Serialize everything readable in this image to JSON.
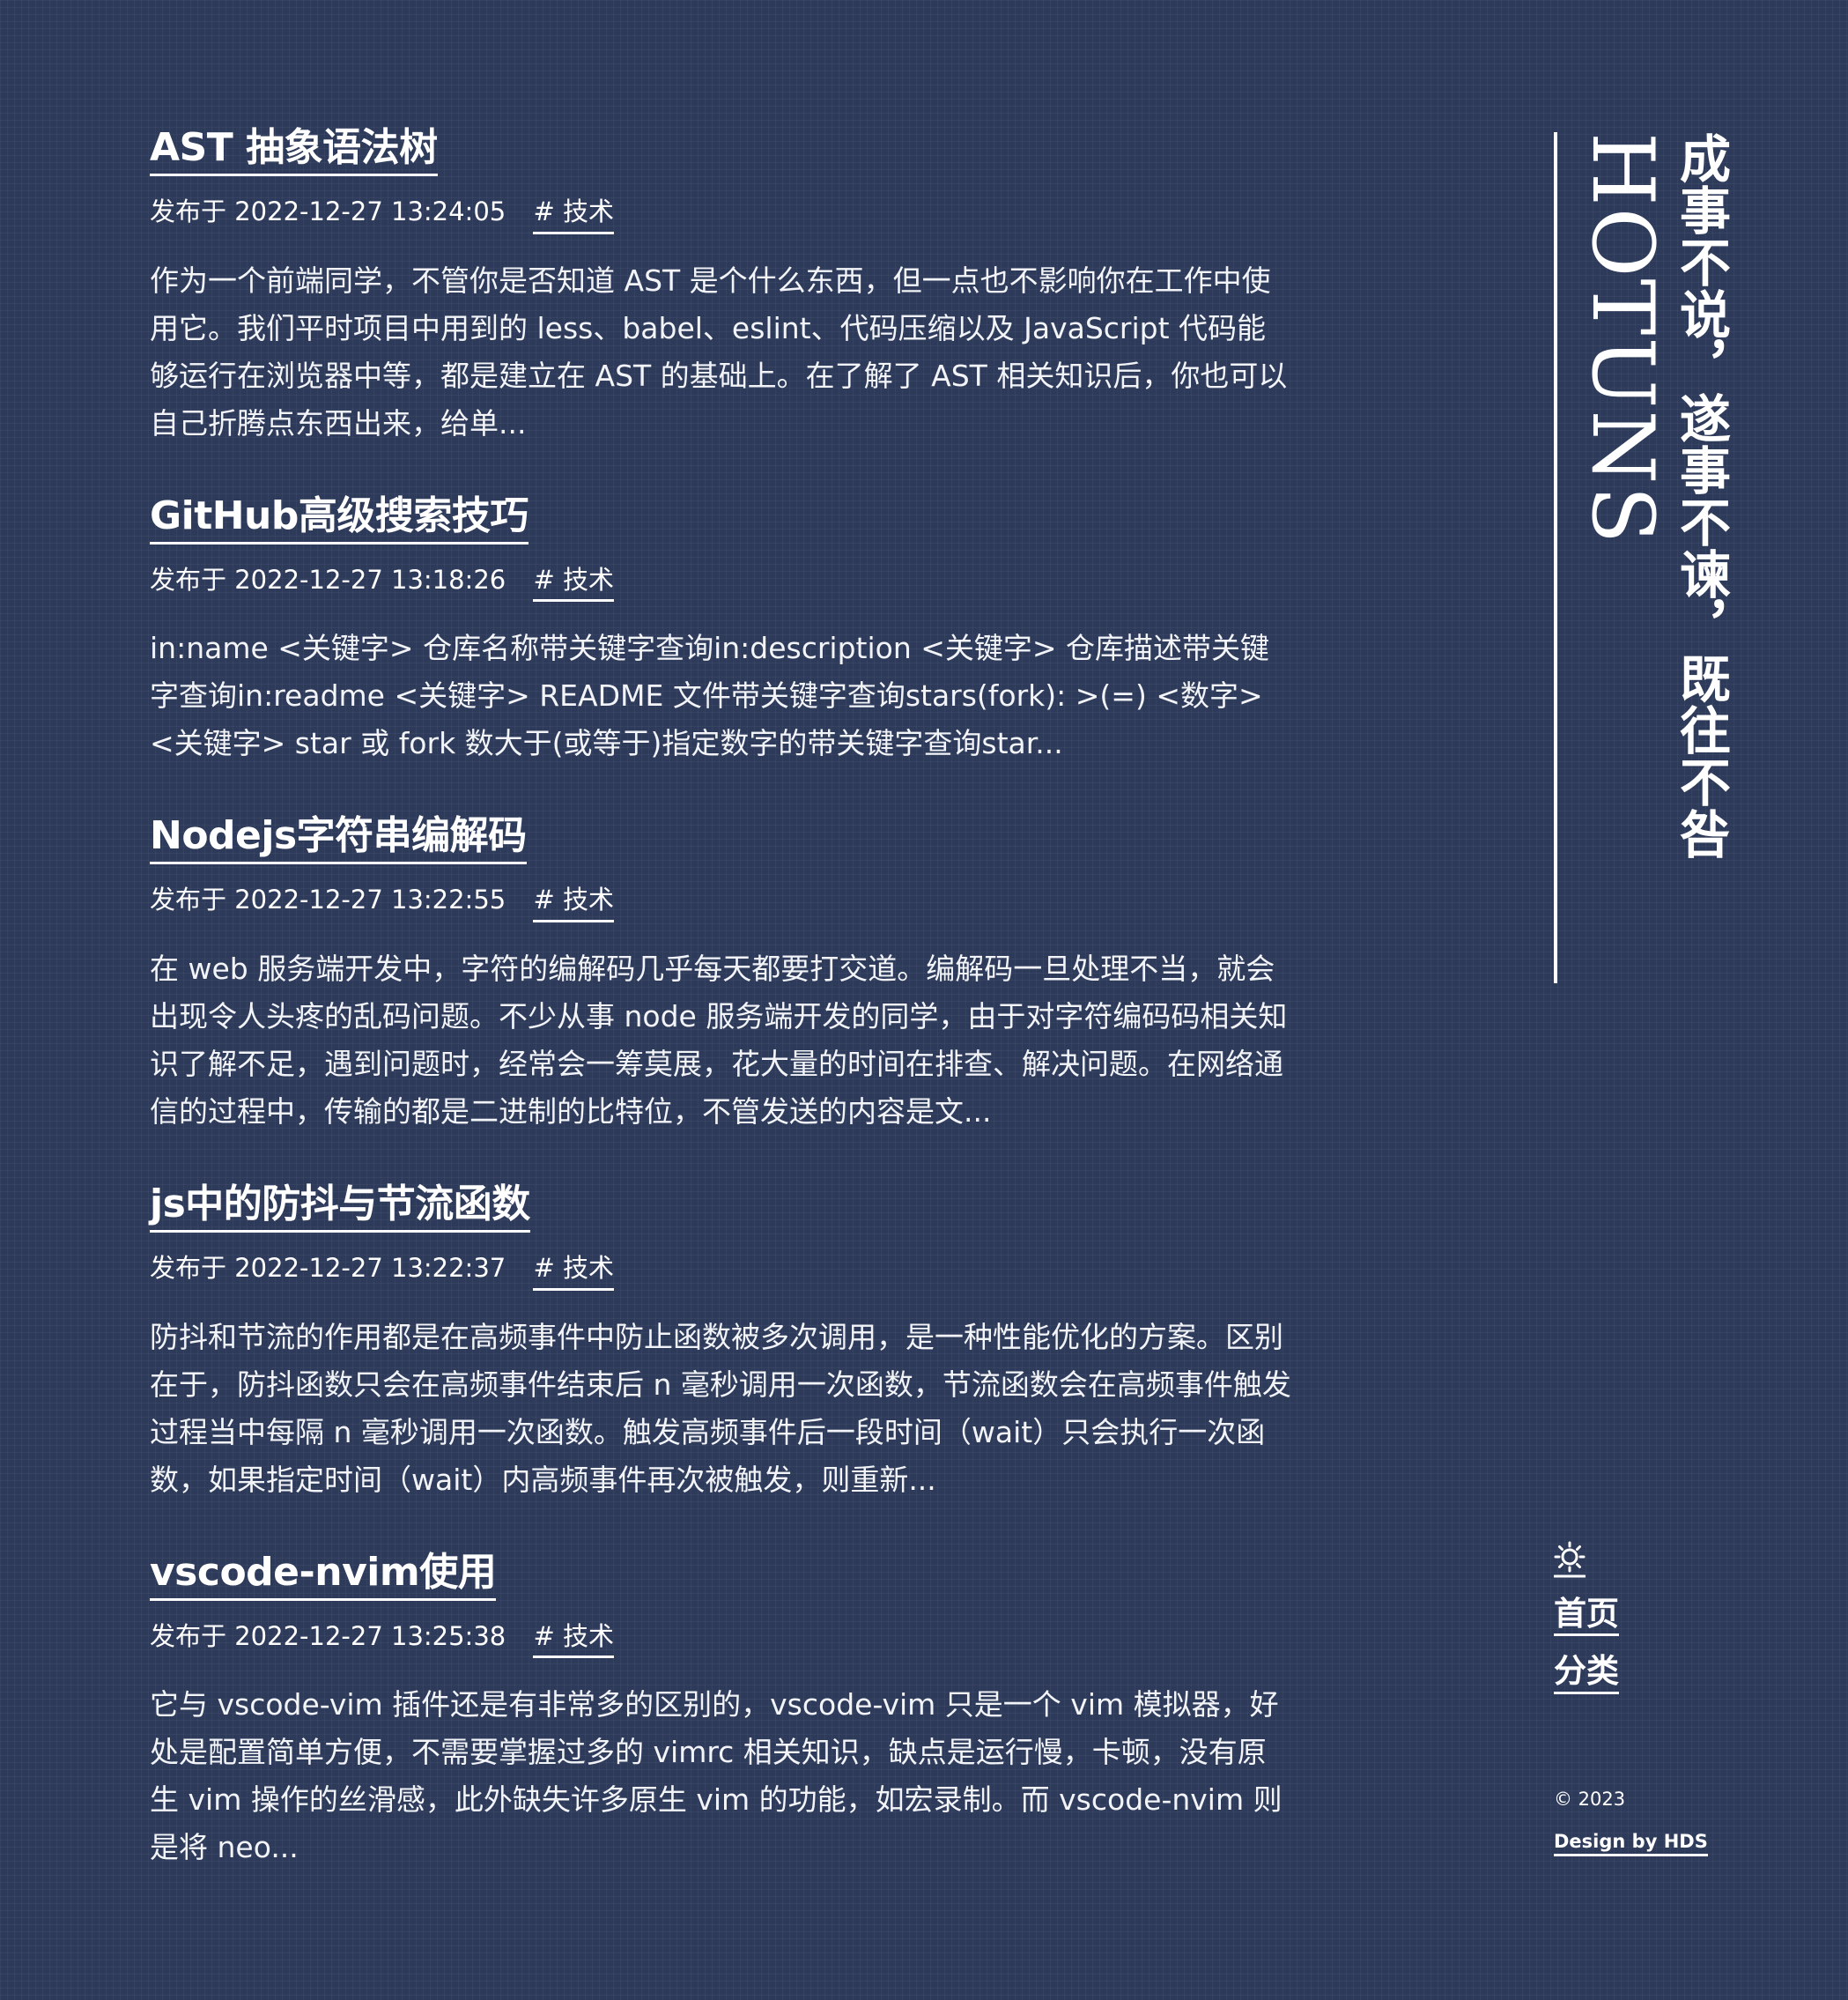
{
  "posts": [
    {
      "title": "AST 抽象语法树",
      "date_prefix": "发布于",
      "date": "2022-12-27 13:24:05",
      "tag": "# 技术",
      "excerpt": "作为一个前端同学，不管你是否知道 AST 是个什么东西，但一点也不影响你在工作中使用它。我们平时项目中用到的 less、babel、eslint、代码压缩以及 JavaScript 代码能够运行在浏览器中等，都是建立在 AST 的基础上。在了解了 AST 相关知识后，你也可以自己折腾点东西出来，给单..."
    },
    {
      "title": "GitHub高级搜索技巧",
      "date_prefix": "发布于",
      "date": "2022-12-27 13:18:26",
      "tag": "# 技术",
      "excerpt": "in:name <关键字> 仓库名称带关键字查询in:description <关键字> 仓库描述带关键字查询in:readme <关键字> README 文件带关键字查询stars(fork): >(=) <数字> <关键字> star 或 fork 数大于(或等于)指定数字的带关键字查询star..."
    },
    {
      "title": "Nodejs字符串编解码",
      "date_prefix": "发布于",
      "date": "2022-12-27 13:22:55",
      "tag": "# 技术",
      "excerpt": "在 web 服务端开发中，字符的编解码几乎每天都要打交道。编解码一旦处理不当，就会出现令人头疼的乱码问题。不少从事 node 服务端开发的同学，由于对字符编码码相关知识了解不足，遇到问题时，经常会一筹莫展，花大量的时间在排查、解决问题。在网络通信的过程中，传输的都是二进制的比特位，不管发送的内容是文..."
    },
    {
      "title": "js中的防抖与节流函数",
      "date_prefix": "发布于",
      "date": "2022-12-27 13:22:37",
      "tag": "# 技术",
      "excerpt": "防抖和节流的作用都是在高频事件中防止函数被多次调用，是一种性能优化的方案。区别在于，防抖函数只会在高频事件结束后 n 毫秒调用一次函数，节流函数会在高频事件触发过程当中每隔 n 毫秒调用一次函数。触发高频事件后一段时间（wait）只会执行一次函数，如果指定时间（wait）内高频事件再次被触发，则重新..."
    },
    {
      "title": "vscode-nvim使用",
      "date_prefix": "发布于",
      "date": "2022-12-27 13:25:38",
      "tag": "# 技术",
      "excerpt": "它与 vscode-vim 插件还是有非常多的区别的，vscode-vim 只是一个 vim 模拟器，好处是配置简单方便，不需要掌握过多的 vimrc 相关知识，缺点是运行慢，卡顿，没有原生 vim 操作的丝滑感，此外缺失许多原生 vim 的功能，如宏录制。而 vscode-nvim 则是将 neo..."
    }
  ],
  "sidebar": {
    "brand": "HOTUNS",
    "motto": "成事不说，遂事不谏，既往不咎",
    "theme_icon": "sun-icon",
    "nav": [
      {
        "label": "首页"
      },
      {
        "label": "分类"
      }
    ],
    "copyright": "© 2023",
    "credit_prefix": "Design by",
    "credit_author": "HDS"
  },
  "colors": {
    "background": "#2d3a5a",
    "text": "#ffffff"
  }
}
